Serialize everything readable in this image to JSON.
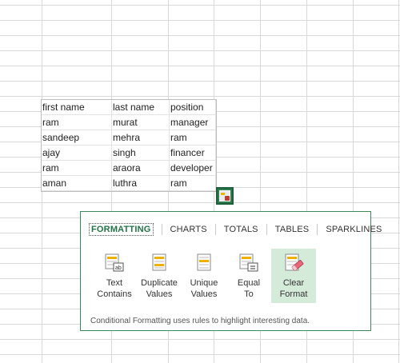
{
  "table": {
    "headers": [
      "first name",
      "last name",
      "position"
    ],
    "rows": [
      [
        "ram",
        "murat",
        "manager"
      ],
      [
        "sandeep",
        "mehra",
        "ram"
      ],
      [
        "ajay",
        "singh",
        "financer"
      ],
      [
        "ram",
        "araora",
        "developer"
      ],
      [
        "aman",
        "luthra",
        "ram"
      ]
    ]
  },
  "quick_analysis": {
    "tabs": [
      "FORMATTING",
      "CHARTS",
      "TOTALS",
      "TABLES",
      "SPARKLINES"
    ],
    "active_tab": "FORMATTING",
    "tools": [
      {
        "label": "Text\nContains",
        "icon": "text-contains-icon"
      },
      {
        "label": "Duplicate\nValues",
        "icon": "duplicate-values-icon"
      },
      {
        "label": "Unique\nValues",
        "icon": "unique-values-icon"
      },
      {
        "label": "Equal\nTo",
        "icon": "equal-to-icon"
      },
      {
        "label": "Clear\nFormat",
        "icon": "clear-format-icon"
      }
    ],
    "selected_tool": "Clear\nFormat",
    "hint": "Conditional Formatting uses rules to highlight interesting data."
  },
  "colors": {
    "accent_green": "#217346",
    "selected_bg": "#d5ebd9",
    "highlight_orange": "#f0b000",
    "eraser_pink": "#e8677a"
  }
}
